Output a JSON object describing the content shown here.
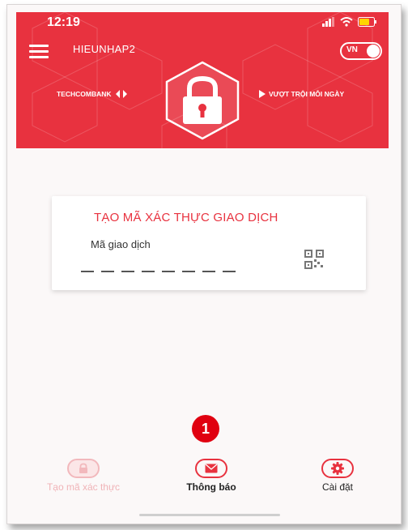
{
  "status_bar": {
    "time": "12:19"
  },
  "header": {
    "username": "HIEUNHAP2",
    "language_toggle": "VN",
    "brand_left": "TECHCOMBANK",
    "brand_right": "VƯỢT TRỘI MỖI NGÀY",
    "bg_color": "#e8323f"
  },
  "card": {
    "title": "TẠO MÃ XÁC THỰC GIAO DỊCH",
    "field_label": "Mã giao dịch",
    "code_slots": 8,
    "accent_color": "#e8323f"
  },
  "badge": {
    "number": "1",
    "color": "#e00010"
  },
  "bottom_nav": {
    "items": [
      {
        "label": "Tạo mã xác thực",
        "icon": "lock-icon",
        "state": "disabled"
      },
      {
        "label": "Thông báo",
        "icon": "mail-icon",
        "state": "active"
      },
      {
        "label": "Cài đặt",
        "icon": "gear-icon",
        "state": "active"
      }
    ]
  }
}
